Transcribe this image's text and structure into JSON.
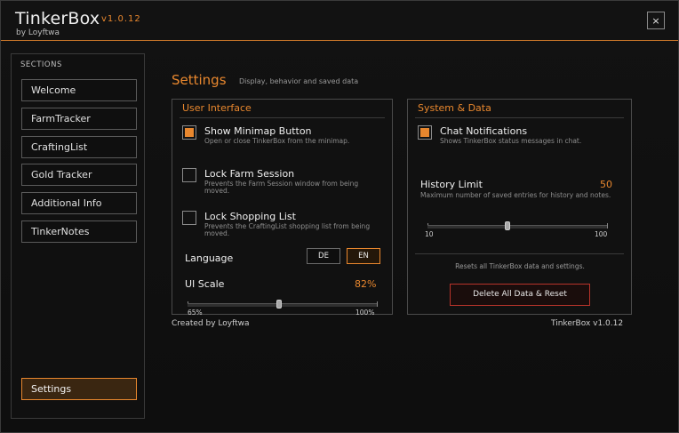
{
  "app": {
    "title": "TinkerBox",
    "version": "v1.0.12",
    "author": "by Loyftwa",
    "close_label": "×"
  },
  "sidebar": {
    "title": "SECTIONS",
    "items": [
      {
        "label": "Welcome"
      },
      {
        "label": "FarmTracker"
      },
      {
        "label": "CraftingList"
      },
      {
        "label": "Gold Tracker"
      },
      {
        "label": "Additional Info"
      },
      {
        "label": "TinkerNotes"
      },
      {
        "label": "Settings",
        "active": true
      }
    ]
  },
  "settings": {
    "title": "Settings",
    "subtitle": "Display, behavior and saved data"
  },
  "ui_panel": {
    "title": "User Interface",
    "options": [
      {
        "label": "Show Minimap Button",
        "desc": "Open or close TinkerBox from the minimap.",
        "checked": true
      },
      {
        "label": "Lock Farm Session",
        "desc": "Prevents the Farm Session window from being moved.",
        "checked": false
      },
      {
        "label": "Lock Shopping List",
        "desc": "Prevents the CraftingList shopping list from being moved.",
        "checked": false
      }
    ],
    "language": {
      "label": "Language",
      "options": [
        "DE",
        "EN"
      ],
      "selected": "EN"
    },
    "ui_scale": {
      "label": "UI Scale",
      "value_text": "82%",
      "value": 82,
      "min": 65,
      "max": 100,
      "min_label": "65%",
      "max_label": "100%"
    }
  },
  "sys_panel": {
    "title": "System & Data",
    "chat": {
      "label": "Chat Notifications",
      "desc": "Shows TinkerBox status messages in chat.",
      "checked": true
    },
    "history": {
      "label": "History Limit",
      "value_text": "50",
      "value": 50,
      "min": 10,
      "max": 100,
      "desc": "Maximum number of saved entries for history and notes.",
      "min_label": "10",
      "max_label": "100"
    },
    "reset_note": "Resets all TinkerBox data and settings.",
    "reset_label": "Delete All Data & Reset"
  },
  "footer": {
    "left": "Created by Loyftwa",
    "right": "TinkerBox v1.0.12"
  },
  "colors": {
    "accent": "#e8872e",
    "danger": "#b8332a"
  }
}
